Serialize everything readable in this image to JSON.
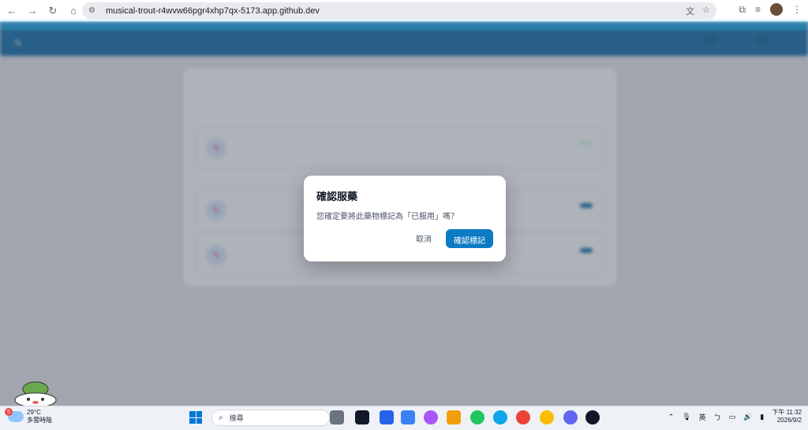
{
  "browser": {
    "url": "musical-trout-r4wvw66pgr4xhp7qx-5173.app.github.dev"
  },
  "modal": {
    "title": "確認服藥",
    "message": "您確定要將此藥物標記為「已服用」嗎？",
    "cancel_label": "取消",
    "confirm_label": "確認標記"
  },
  "taskbar": {
    "weather_temp": "29°C",
    "weather_desc": "多雲時陰",
    "weather_badge": "5",
    "search_placeholder": "搜尋",
    "ime_lang": "英",
    "ime_mode": "ㄅ",
    "time_period": "下午 11:32",
    "date": "2026/9/2"
  },
  "colors": {
    "header_blue": "#0b6aa8",
    "accent": "#0ea5e9",
    "confirm_button": "#0b7bc4"
  }
}
